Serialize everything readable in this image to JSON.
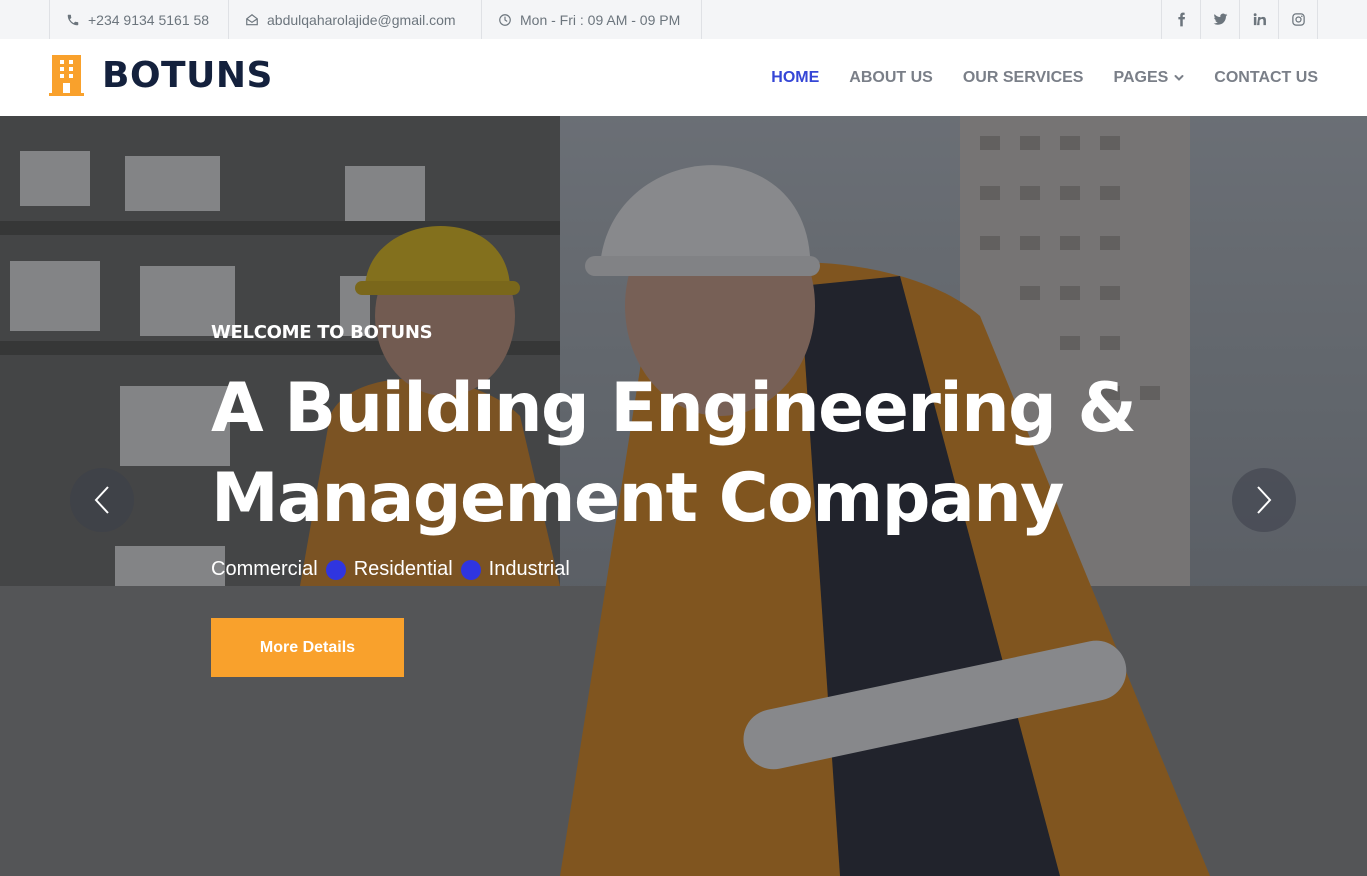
{
  "topbar": {
    "phone": "+234 9134 5161 58",
    "email": "abdulqaharolajide@gmail.com",
    "hours": "Mon - Fri : 09 AM - 09 PM",
    "socials": [
      "facebook-icon",
      "twitter-icon",
      "linkedin-icon",
      "instagram-icon"
    ]
  },
  "brand": {
    "name": "BOTUNS",
    "icon": "building-icon",
    "icon_color": "#f9a12c"
  },
  "nav": {
    "items": [
      {
        "label": "HOME",
        "active": true
      },
      {
        "label": "ABOUT US"
      },
      {
        "label": "OUR SERVICES"
      },
      {
        "label": "PAGES",
        "dropdown": true
      },
      {
        "label": "CONTACT US"
      }
    ],
    "active_color": "#3546d6"
  },
  "hero": {
    "eyebrow": "WELCOME TO BOTUNS",
    "title": "A Building Engineering & Management Company",
    "tags": [
      "Commercial",
      "Residential",
      "Industrial"
    ],
    "tag_dot_color": "#2f35e0",
    "button_label": "More Details",
    "button_color": "#f9a12c"
  }
}
